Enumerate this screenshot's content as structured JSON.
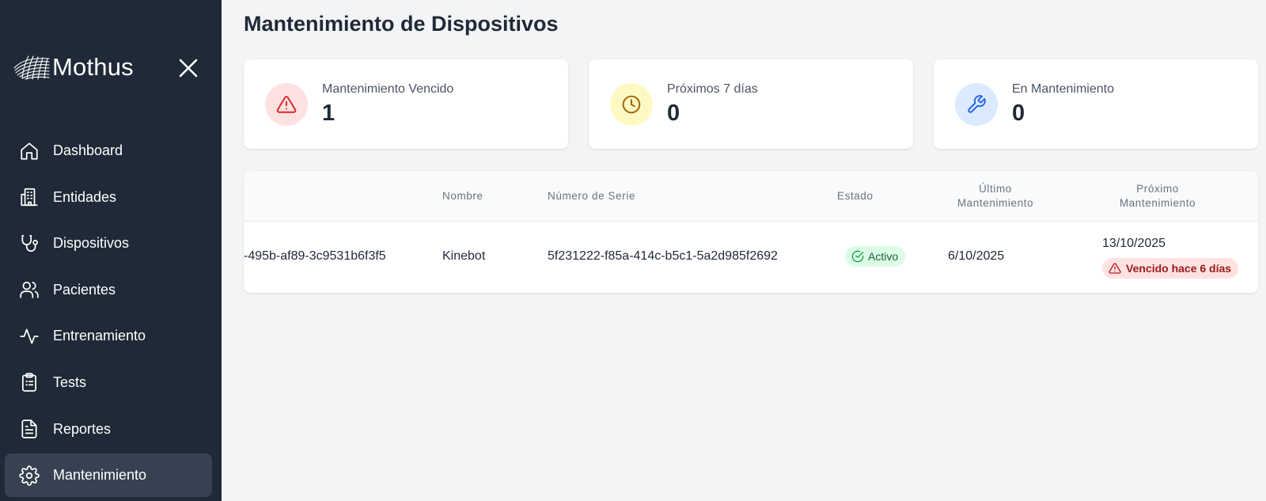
{
  "brand": {
    "name": "Mothus"
  },
  "sidebar": {
    "items": [
      {
        "label": "Dashboard",
        "icon": "home-icon"
      },
      {
        "label": "Entidades",
        "icon": "building-icon"
      },
      {
        "label": "Dispositivos",
        "icon": "stethoscope-icon"
      },
      {
        "label": "Pacientes",
        "icon": "users-icon"
      },
      {
        "label": "Entrenamiento",
        "icon": "activity-icon"
      },
      {
        "label": "Tests",
        "icon": "clipboard-list-icon"
      },
      {
        "label": "Reportes",
        "icon": "file-text-icon"
      },
      {
        "label": "Mantenimiento",
        "icon": "gear-icon",
        "active": true
      }
    ]
  },
  "page": {
    "title": "Mantenimiento de Dispositivos"
  },
  "stats": [
    {
      "label": "Mantenimiento Vencido",
      "value": "1",
      "icon": "alert-triangle-icon",
      "color": "#dc2626",
      "bg": "#fee2e2"
    },
    {
      "label": "Próximos 7 días",
      "value": "0",
      "icon": "clock-icon",
      "color": "#a16207",
      "bg": "#fef9c3"
    },
    {
      "label": "En Mantenimiento",
      "value": "0",
      "icon": "wrench-icon",
      "color": "#2563eb",
      "bg": "#dbeafe"
    }
  ],
  "table": {
    "headers": {
      "nombre": "Nombre",
      "serie": "Número de Serie",
      "estado": "Estado",
      "ultimo_1": "Último",
      "ultimo_2": "Mantenimiento",
      "proximo_1": "Próximo",
      "proximo_2": "Mantenimiento"
    },
    "rows": [
      {
        "id": "-495b-af89-3c9531b6f3f5",
        "nombre": "Kinebot",
        "serie": "5f231222-f85a-414c-b5c1-5a2d985f2692",
        "estado": "Activo",
        "ultimo": "6/10/2025",
        "proximo": "13/10/2025",
        "alerta": "Vencido hace 6 días"
      }
    ]
  },
  "colors": {
    "sidebar_bg": "#1f2937",
    "active_bg": "#374151",
    "page_bg": "#f3f4f6"
  }
}
